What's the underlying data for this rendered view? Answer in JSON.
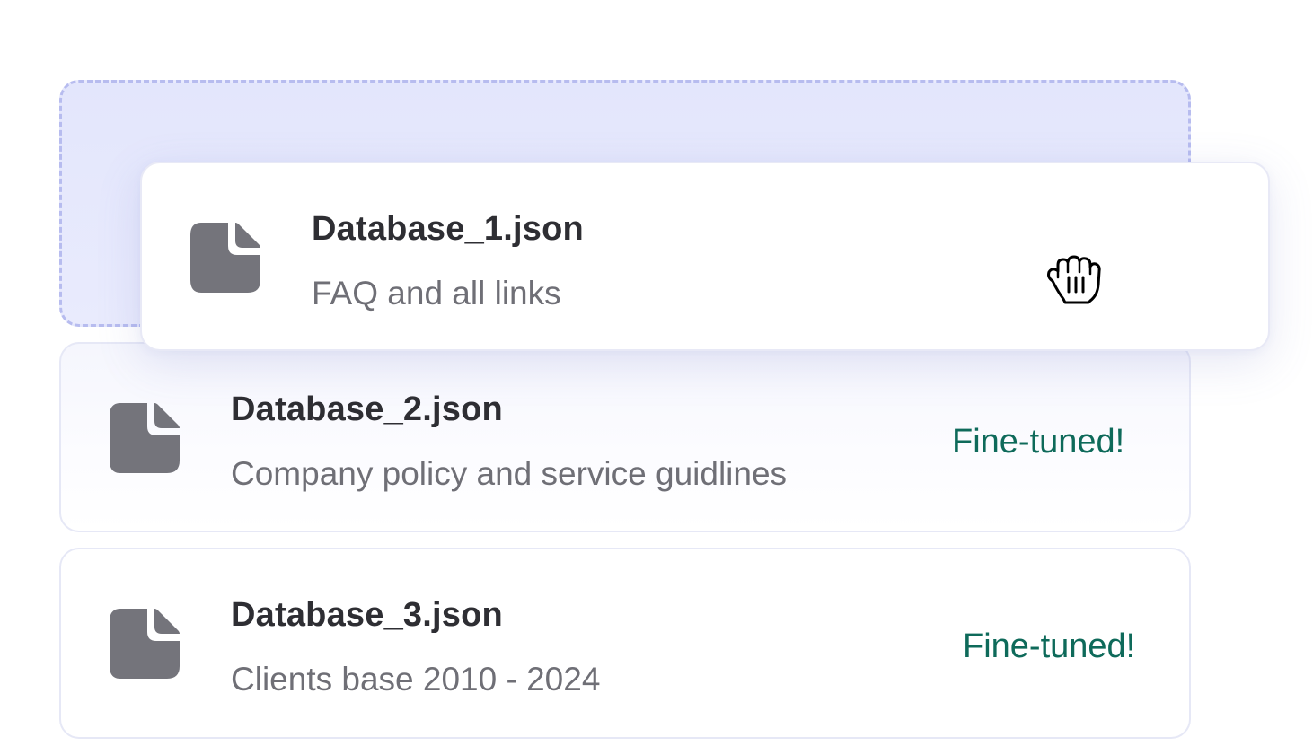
{
  "files": [
    {
      "name": "Database_1.json",
      "description": "FAQ and all links",
      "status": "",
      "state": "dragging"
    },
    {
      "name": "Database_2.json",
      "description": "Company policy and service guidlines",
      "status": "Fine-tuned!"
    },
    {
      "name": "Database_3.json",
      "description": "Clients base 2010 - 2024",
      "status": "Fine-tuned!"
    }
  ],
  "icons": {
    "file": "document-icon",
    "cursor": "grab-hand-cursor-icon"
  },
  "colors": {
    "drop_zone_fill": "#e4e7fc",
    "drop_zone_border": "#b7bcef",
    "icon_gray": "#74747b",
    "status_green": "#0e6a5a",
    "title_text": "#2e2e33",
    "desc_text": "#6f6f76"
  }
}
